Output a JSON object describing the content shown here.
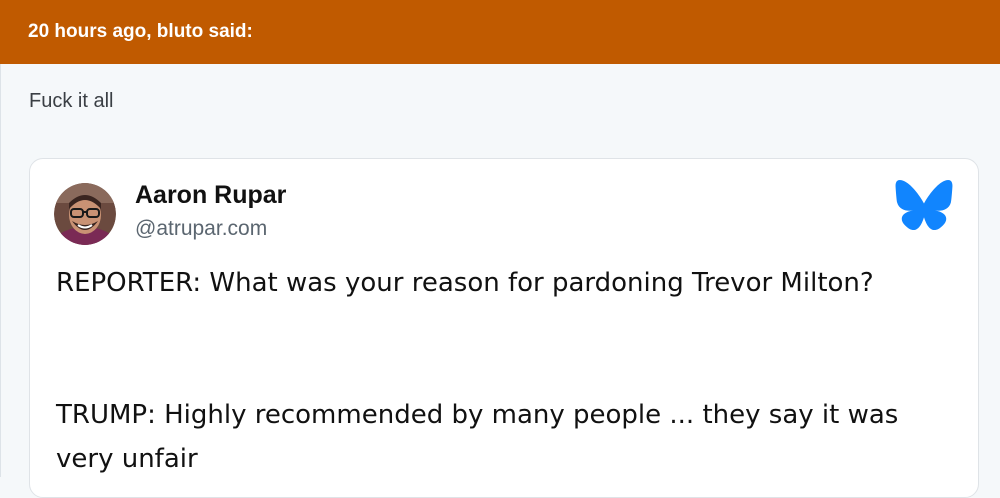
{
  "quote": {
    "header": "20 hours ago, bluto said:",
    "text": "Fuck it all"
  },
  "embed": {
    "author_name": "Aaron Rupar",
    "author_handle": "@atrupar.com",
    "avatar_icon": "avatar-photo",
    "platform_icon": "bluesky-butterfly-icon",
    "platform_color": "#1185fe",
    "paragraphs": [
      "REPORTER: What was your reason for pardoning Trevor Milton?",
      "TRUMP: Highly recommended by many people ... they say it was very unfair"
    ]
  },
  "colors": {
    "header_bg": "#c05a00",
    "body_bg": "#f5f8fa"
  }
}
